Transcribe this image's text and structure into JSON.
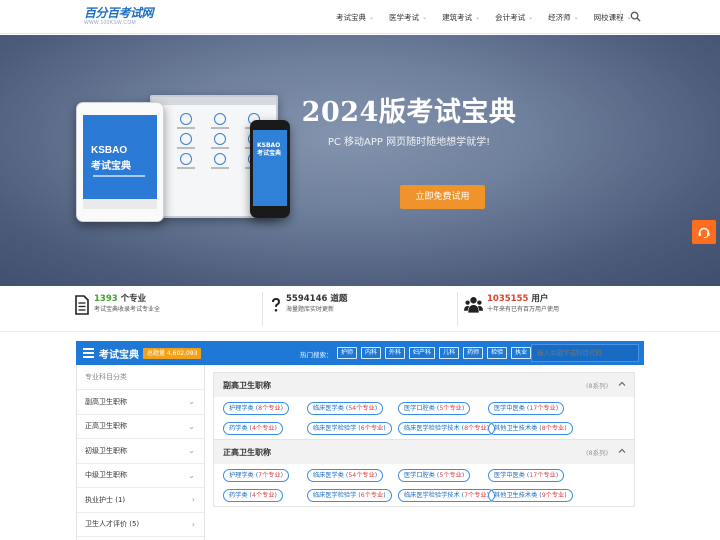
{
  "header": {
    "logo_text": "百分百考试网",
    "logo_sub": "WWW.100KSW.COM",
    "nav": [
      {
        "label": "考试宝典",
        "caret": "⌄"
      },
      {
        "label": "医学考试",
        "caret": "⌄"
      },
      {
        "label": "建筑考试",
        "caret": "⌄"
      },
      {
        "label": "会计考试",
        "caret": "⌄"
      },
      {
        "label": "经济师",
        "caret": "⌄"
      },
      {
        "label": "网校课程",
        "caret": "⌄"
      }
    ]
  },
  "banner": {
    "title": "2024版考试宝典",
    "subtitle": "PC 移动APP 网页随时随地想学就学!",
    "cta": "立即免费试用",
    "tablet_brand_top": "KSBAO",
    "tablet_brand_bottom": "考试宝典",
    "phone_brand_top": "KSBAO",
    "phone_brand_bottom": "考试宝典"
  },
  "stats": [
    {
      "num": "1393",
      "unit": " 个专业",
      "desc": "考试宝典收录考试专业全",
      "color": "#3fa32f"
    },
    {
      "num": "5594146",
      "unit": " 道题",
      "desc": "海量题库实时更新",
      "color": "#333333"
    },
    {
      "num": "1035155",
      "unit": " 用户",
      "desc": "十年来有已有百万用户使用",
      "color": "#e0402f"
    }
  ],
  "module": {
    "title": "考试宝典",
    "badge": "总题量 4,602,093",
    "hot_label": "热门搜索：",
    "hot_tags": [
      "护师",
      "内科",
      "外科",
      "妇产科",
      "儿科",
      "药师",
      "检验",
      "执业"
    ],
    "search_placeholder": "输入关键字或科目代码"
  },
  "sidebar": {
    "heading": "专业科目分类",
    "items": [
      {
        "label": "副高卫生职称",
        "chev": "⌄"
      },
      {
        "label": "正高卫生职称",
        "chev": "⌄"
      },
      {
        "label": "初级卫生职称",
        "chev": "⌄"
      },
      {
        "label": "中级卫生职称",
        "chev": "⌄"
      },
      {
        "label": "执业护士 (1)",
        "chev": "›"
      },
      {
        "label": "卫生人才评价 (5)",
        "chev": "›"
      }
    ]
  },
  "categories": [
    {
      "title": "副高卫生职称",
      "count": "(8系列)",
      "pills": [
        {
          "name": "护理学类",
          "num": "8个专业"
        },
        {
          "name": "临床医学类",
          "num": "54个专业"
        },
        {
          "name": "医学口腔类",
          "num": "5个专业"
        },
        {
          "name": "医学中医类",
          "num": "17个专业"
        },
        {
          "name": "药学类",
          "num": "4个专业"
        },
        {
          "name": "临床医学检验学",
          "num": "6个专业"
        },
        {
          "name": "临床医学检验学技术",
          "num": "8个专业"
        },
        {
          "name": "其他卫生技术类",
          "num": "8个专业"
        }
      ]
    },
    {
      "title": "正高卫生职称",
      "count": "(8系列)",
      "pills": [
        {
          "name": "护理学类",
          "num": "7个专业"
        },
        {
          "name": "临床医学类",
          "num": "54个专业"
        },
        {
          "name": "医学口腔类",
          "num": "5个专业"
        },
        {
          "name": "医学中医类",
          "num": "17个专业"
        },
        {
          "name": "药学类",
          "num": "4个专业"
        },
        {
          "name": "临床医学检验学",
          "num": "6个专业"
        },
        {
          "name": "临床医学检验学技术",
          "num": "7个专业"
        },
        {
          "name": "其他卫生技术类",
          "num": "9个专业"
        }
      ]
    }
  ]
}
